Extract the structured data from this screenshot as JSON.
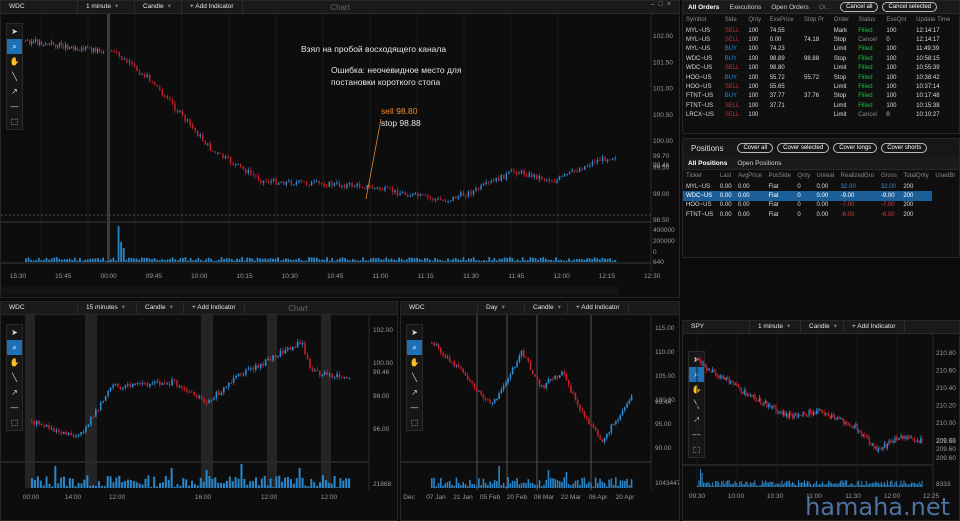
{
  "main_chart": {
    "symbol": "WDC",
    "interval": "1 minute",
    "type": "Candle",
    "add_indicator": "+ Add Indicator",
    "title": "Chart",
    "annotation_1": "Взял на пробой восходящего канала",
    "annotation_2_line1": "Ошибка: неочевидное место для",
    "annotation_2_line2": "постановки короткого стопа",
    "sell_label": "sell 98.80",
    "stop_label": "stop 98.88",
    "price_ticks": [
      "102.00",
      "101.50",
      "101.00",
      "100.50",
      "100.00",
      "99.50",
      "99.00",
      "98.50"
    ],
    "last_price_1": "99.70",
    "last_price_2": "99.46",
    "vol_ticks": [
      "400000",
      "200000",
      "0"
    ],
    "vol_last": "640",
    "time_ticks": [
      "15:30",
      "15:45",
      "00:00",
      "09:45",
      "10:00",
      "10:15",
      "10:30",
      "10:45",
      "11:00",
      "11:15",
      "11:30",
      "11:45",
      "12:00",
      "12:15",
      "12:30"
    ]
  },
  "orders": {
    "tabs": [
      "All Orders",
      "Executions",
      "Open Orders",
      "Or..."
    ],
    "cancel_all": "Cancel all",
    "cancel_selected": "Cancel selected",
    "columns": [
      "Symbol",
      "Side",
      "Qnty",
      "ExePrice",
      "Stop Pr",
      "Order",
      "Status",
      "ExeQnt",
      "Update Time"
    ],
    "rows": [
      {
        "symbol": "MYL~US",
        "side": "SELL",
        "qty": "100",
        "price": "74.55",
        "stop": "",
        "order": "Mark",
        "status": "Filled",
        "exeq": "100",
        "time": "12:14:17"
      },
      {
        "symbol": "MYL~US",
        "side": "SELL",
        "qty": "100",
        "price": "0.00",
        "stop": "74.18",
        "order": "Stop",
        "status": "Cancel",
        "exeq": "0",
        "time": "12:14:17"
      },
      {
        "symbol": "MYL~US",
        "side": "BUY",
        "qty": "100",
        "price": "74.23",
        "stop": "",
        "order": "Limit",
        "status": "Filled",
        "exeq": "100",
        "time": "11:49:39"
      },
      {
        "symbol": "WDC~US",
        "side": "BUY",
        "qty": "100",
        "price": "98.89",
        "stop": "98.88",
        "order": "Stop",
        "status": "Filled",
        "exeq": "100",
        "time": "10:58:15"
      },
      {
        "symbol": "WDC~US",
        "side": "SELL",
        "qty": "100",
        "price": "98.80",
        "stop": "",
        "order": "Limit",
        "status": "Filled",
        "exeq": "100",
        "time": "10:55:39"
      },
      {
        "symbol": "HOG~US",
        "side": "BUY",
        "qty": "100",
        "price": "55.72",
        "stop": "55.72",
        "order": "Stop",
        "status": "Filled",
        "exeq": "100",
        "time": "10:38:42"
      },
      {
        "symbol": "HOG~US",
        "side": "SELL",
        "qty": "100",
        "price": "55.65",
        "stop": "",
        "order": "Limit",
        "status": "Filled",
        "exeq": "100",
        "time": "10:37:14"
      },
      {
        "symbol": "FTNT~US",
        "side": "BUY",
        "qty": "100",
        "price": "37.77",
        "stop": "37.76",
        "order": "Stop",
        "status": "Filled",
        "exeq": "100",
        "time": "10:17:48"
      },
      {
        "symbol": "FTNT~US",
        "side": "SELL",
        "qty": "100",
        "price": "37.71",
        "stop": "",
        "order": "Limit",
        "status": "Filled",
        "exeq": "100",
        "time": "10:15:38"
      },
      {
        "symbol": "LRCX~US",
        "side": "SELL",
        "qty": "100",
        "price": "",
        "stop": "",
        "order": "Limit",
        "status": "Cancel",
        "exeq": "0",
        "time": "10:10:27"
      }
    ]
  },
  "positions": {
    "title": "Positions",
    "buttons": [
      "Cover all",
      "Cover selected",
      "Cover longs",
      "Cover shorts"
    ],
    "tabs": [
      "All Positions",
      "Open Positions"
    ],
    "columns": [
      "Ticker",
      "Last",
      "AvgPrice",
      "PosSide",
      "Qnty",
      "Unreal",
      "RealizedGro",
      "Gross",
      "TotalQnty",
      "UsedBr"
    ],
    "rows": [
      {
        "ticker": "MYL~US",
        "last": "0.00",
        "avg": "0.00",
        "side": "Flat",
        "qty": "0",
        "unreal": "0.00",
        "real": "32.00",
        "gross": "32.00",
        "total": "200",
        "sign": "pos"
      },
      {
        "ticker": "WDC~US",
        "last": "0.00",
        "avg": "0.00",
        "side": "Flat",
        "qty": "0",
        "unreal": "0.00",
        "real": "-9.00",
        "gross": "-9.00",
        "total": "200",
        "sign": "neg"
      },
      {
        "ticker": "HOG~US",
        "last": "0.00",
        "avg": "0.00",
        "side": "Flat",
        "qty": "0",
        "unreal": "0.00",
        "real": "-7.00",
        "gross": "-7.00",
        "total": "200",
        "sign": "neg"
      },
      {
        "ticker": "FTNT~US",
        "last": "0.00",
        "avg": "0.00",
        "side": "Flat",
        "qty": "0",
        "unreal": "0.00",
        "real": "-6.00",
        "gross": "-6.00",
        "total": "200",
        "sign": "neg"
      }
    ]
  },
  "chart_15m": {
    "symbol": "WDC",
    "interval": "15 minutes",
    "type": "Candle",
    "add_indicator": "+ Add Indicator",
    "title": "Chart",
    "price_ticks": [
      "102.00",
      "100.00",
      "98.00",
      "96.00"
    ],
    "last": "99.46",
    "vol_last": "21868",
    "time_ticks": [
      "00:00",
      "14:00",
      "12:00",
      "16:00",
      "12:00",
      "12:00"
    ]
  },
  "chart_day": {
    "symbol": "WDC",
    "interval": "Day",
    "type": "Candle",
    "add_indicator": "+ Add Indicator",
    "price_ticks": [
      "115.00",
      "110.00",
      "105.00",
      "100.00",
      "95.00",
      "90.00"
    ],
    "last": "99.46",
    "vol_last": "1043447",
    "time_ticks": [
      "Dec",
      "07 Jan",
      "21 Jan",
      "05 Feb",
      "20 Feb",
      "08 Mar",
      "22 Mar",
      "06 Apr",
      "20 Apr"
    ]
  },
  "chart_spy": {
    "symbol": "SPY",
    "interval": "1 minute",
    "type": "Candle",
    "add_indicator": "+ Add Indicator",
    "price_ticks": [
      "210.80",
      "210.60",
      "210.40",
      "210.20",
      "210.00",
      "209.80",
      "209.60"
    ],
    "last_1": "209.68",
    "last_2": "209.60",
    "vol_last": "8333",
    "time_ticks": [
      "09:30",
      "10:00",
      "10:30",
      "11:00",
      "11:30",
      "12:00",
      "12:25"
    ]
  },
  "watermark": "hamaha.net"
}
